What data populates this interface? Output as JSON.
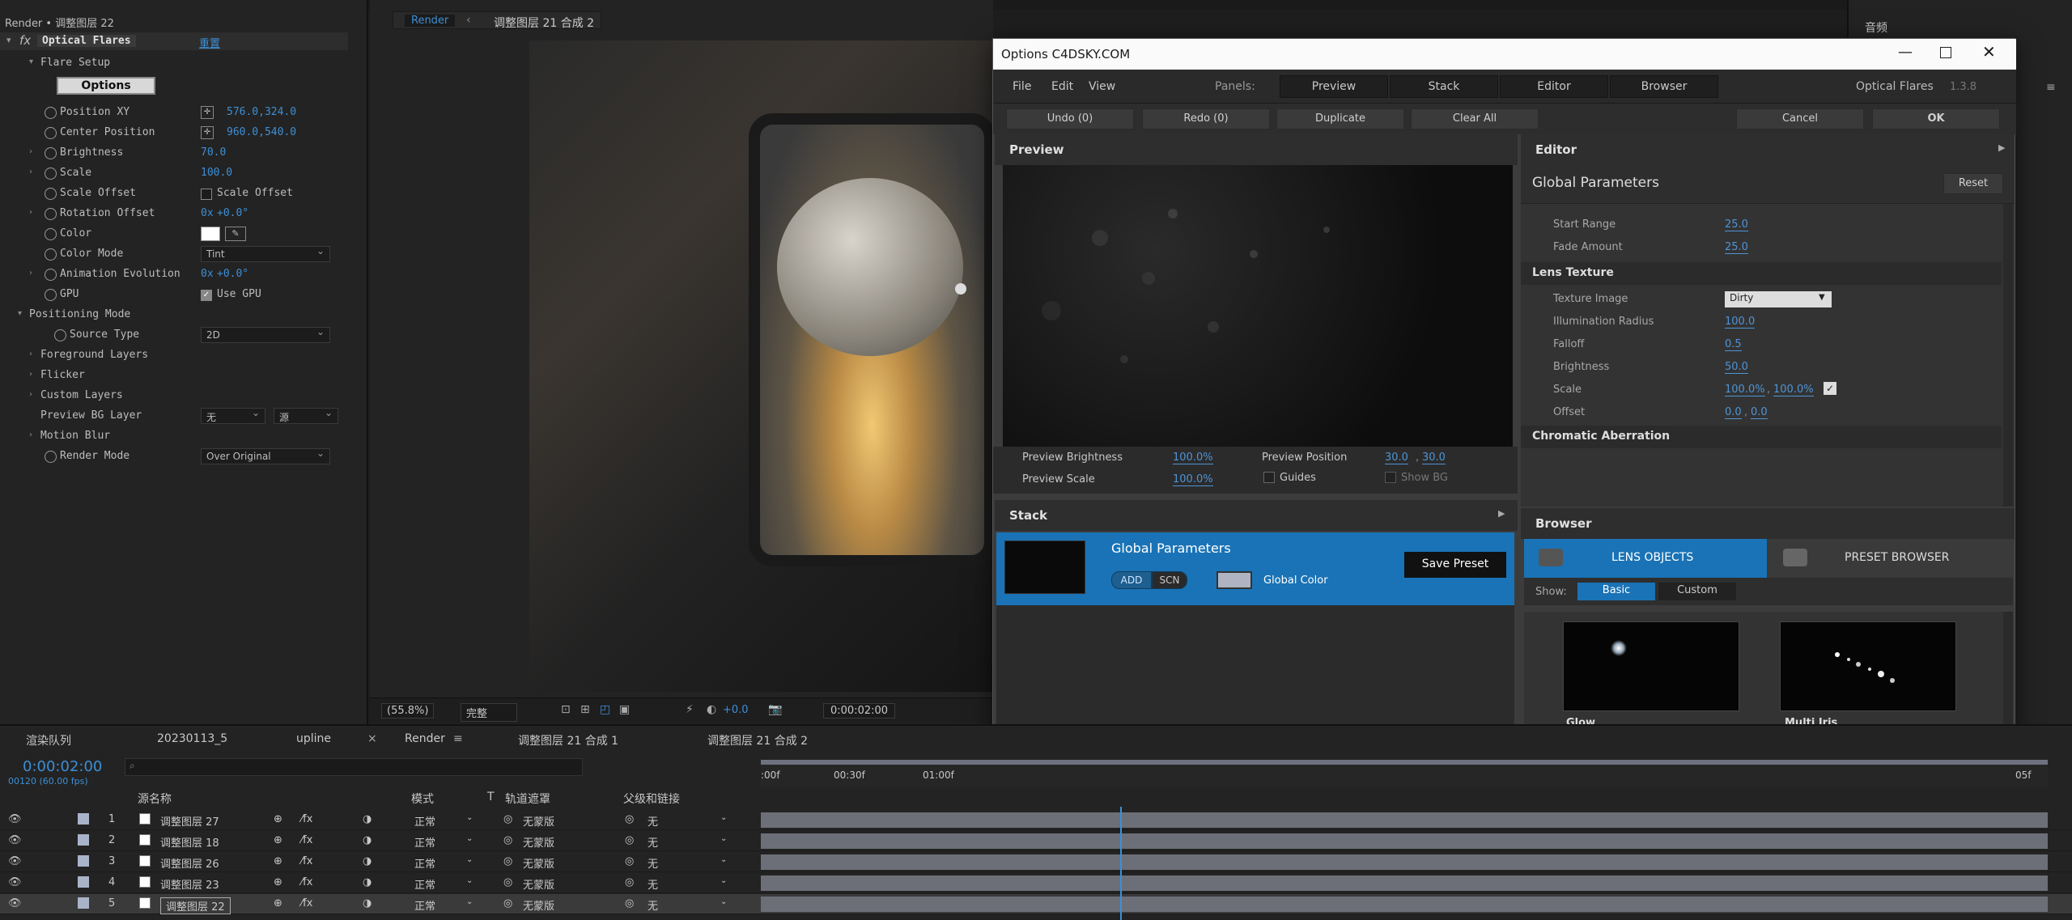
{
  "fx_panel": {
    "header": "Render • 调整图层 22",
    "effect_name": "Optical Flares",
    "reset_label": "重置",
    "flare_setup": "Flare Setup",
    "options_button": "Options",
    "rows": [
      {
        "label": "Position XY",
        "value": "576.0,324.0"
      },
      {
        "label": "Center Position",
        "value": "960.0,540.0"
      },
      {
        "label": "Brightness",
        "value": "70.0"
      },
      {
        "label": "Scale",
        "value": "100.0"
      },
      {
        "label": "Scale Offset",
        "value": "Scale Offset"
      },
      {
        "label": "Rotation Offset",
        "value_prefix": "0x",
        "value": "+0.0°"
      },
      {
        "label": "Color",
        "value": ""
      },
      {
        "label": "Color Mode",
        "value": "Tint"
      },
      {
        "label": "Animation Evolution",
        "value_prefix": "0x",
        "value": "+0.0°"
      },
      {
        "label": "GPU",
        "value": "Use GPU"
      },
      {
        "label": "Positioning Mode",
        "value": ""
      },
      {
        "label": "Source Type",
        "value": "2D"
      },
      {
        "label": "Foreground Layers",
        "value": ""
      },
      {
        "label": "Flicker",
        "value": ""
      },
      {
        "label": "Custom Layers",
        "value": ""
      },
      {
        "label": "Preview BG Layer",
        "value": "无",
        "value2": "源"
      },
      {
        "label": "Motion Blur",
        "value": ""
      },
      {
        "label": "Render Mode",
        "value": "Over Original"
      }
    ]
  },
  "viewer": {
    "tab_label": "Render",
    "breadcrumb": "调整图层 21 合成 2",
    "zoom": "(55.8%)",
    "quality": "完整",
    "exposure": "+0.0",
    "timecode": "0:00:02:00"
  },
  "right_panel": {
    "label": "音频"
  },
  "dialog": {
    "title": "Options C4DSKY.COM",
    "menu": [
      "File",
      "Edit",
      "View"
    ],
    "panels_label": "Panels:",
    "panel_tabs": [
      "Preview",
      "Stack",
      "Editor",
      "Browser"
    ],
    "brand": "Optical Flares",
    "version": "1.3.8",
    "actions": [
      "Undo (0)",
      "Redo (0)",
      "Duplicate",
      "Clear All"
    ],
    "cancel": "Cancel",
    "ok": "OK",
    "preview": {
      "heading": "Preview",
      "brightness_label": "Preview Brightness",
      "brightness_value": "100.0%",
      "scale_label": "Preview Scale",
      "scale_value": "100.0%",
      "position_label": "Preview Position",
      "position_x": "30.0",
      "position_y": "30.0",
      "guides_label": "Guides",
      "showbg_label": "Show BG"
    },
    "stack": {
      "heading": "Stack",
      "item_title": "Global Parameters",
      "add": "ADD",
      "scn": "SCN",
      "global_color": "Global Color",
      "save_preset": "Save Preset"
    },
    "editor": {
      "heading": "Editor",
      "subheading": "Global Parameters",
      "reset": "Reset",
      "rows_top": [
        {
          "label": "Start Range",
          "value": "25.0"
        },
        {
          "label": "Fade Amount",
          "value": "25.0"
        }
      ],
      "lens_texture": "Lens Texture",
      "texture_image_label": "Texture Image",
      "texture_image_value": "Dirty",
      "rows_texture": [
        {
          "label": "Illumination Radius",
          "value": "100.0"
        },
        {
          "label": "Falloff",
          "value": "0.5"
        },
        {
          "label": "Brightness",
          "value": "50.0"
        }
      ],
      "scale_label": "Scale",
      "scale_x": "100.0%",
      "scale_y": "100.0%",
      "offset_label": "Offset",
      "offset_x": "0.0",
      "offset_y": "0.0",
      "chromatic": "Chromatic Aberration"
    },
    "browser": {
      "heading": "Browser",
      "tab_lens": "LENS OBJECTS",
      "tab_preset": "PRESET BROWSER",
      "show_label": "Show:",
      "basic": "Basic",
      "custom": "Custom",
      "items": [
        "Glow",
        "Multi Iris",
        "",
        ""
      ]
    }
  },
  "timeline": {
    "tabs": [
      "渲染队列",
      "20230113_5",
      "upline",
      "Render",
      "调整图层 21 合成 1",
      "调整图层 21 合成 2"
    ],
    "timecode": "0:00:02:00",
    "fps": "00120 (60.00 fps)",
    "ruler": [
      ":00f",
      "00:30f",
      "01:00f",
      "05f"
    ],
    "columns": {
      "source": "源名称",
      "mode": "模式",
      "t": "T",
      "track": "轨道遮罩",
      "parent": "父级和链接"
    },
    "layers": [
      {
        "num": "1",
        "name": "调整图层 27",
        "mode": "正常",
        "matte": "无蒙版",
        "parent": "无"
      },
      {
        "num": "2",
        "name": "调整图层 18",
        "mode": "正常",
        "matte": "无蒙版",
        "parent": "无"
      },
      {
        "num": "3",
        "name": "调整图层 26",
        "mode": "正常",
        "matte": "无蒙版",
        "parent": "无"
      },
      {
        "num": "4",
        "name": "调整图层 23",
        "mode": "正常",
        "matte": "无蒙版",
        "parent": "无"
      },
      {
        "num": "5",
        "name": "调整图层 22",
        "mode": "正常",
        "matte": "无蒙版",
        "parent": "无"
      }
    ]
  }
}
